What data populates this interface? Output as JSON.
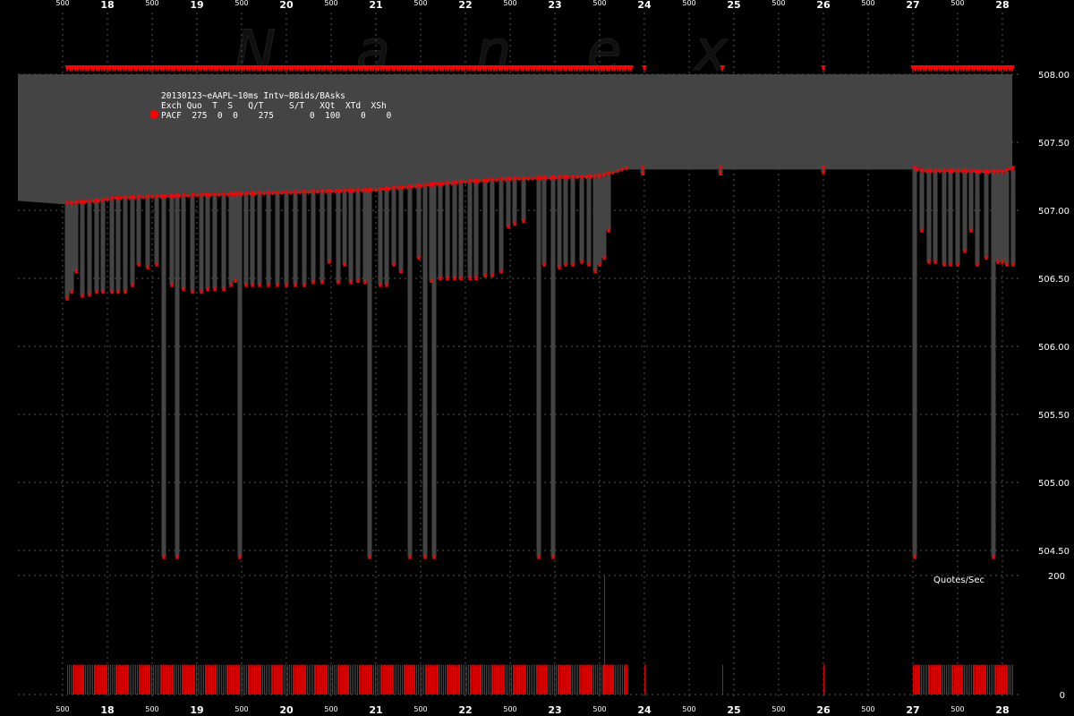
{
  "watermark": [
    "N",
    "a",
    "n",
    "e",
    "x"
  ],
  "info_panel": {
    "title": "20130123~eAAPL~10ms Intv~BBids/BAsks",
    "header": "Exch Quo  T  S   Q/T     S/T   XQt  XTd  XSh",
    "row": "PACF  275  0  0    275       0  100    0    0",
    "marker_color": "#ff0000"
  },
  "colors": {
    "background": "#000000",
    "spread_fill": "#444444",
    "marker": "#ff0000",
    "grid": "#555555",
    "text": "#ffffff",
    "quote_bar": "#dd0000"
  },
  "chart_data": {
    "type": "area",
    "title": "20130123~eAAPL~10ms Intv~BBids/BAsks",
    "x_major_ticks": [
      "18",
      "19",
      "20",
      "21",
      "22",
      "23",
      "24",
      "25",
      "26",
      "27",
      "28"
    ],
    "x_minor_tick_label": "500",
    "xlim": [
      17.45,
      28.12
    ],
    "price_panel": {
      "ylim": [
        504.3,
        508.3
      ],
      "y_ticks": [
        "504.50",
        "505.00",
        "505.50",
        "506.00",
        "506.50",
        "507.00",
        "507.50",
        "508.00"
      ],
      "best_ask_level": 508.0,
      "series": [
        {
          "name": "BBids",
          "points": [
            [
              17.0,
              507.07
            ],
            [
              17.6,
              507.04
            ],
            [
              17.7,
              507.05
            ],
            [
              17.9,
              507.06
            ],
            [
              18.1,
              507.08
            ],
            [
              18.5,
              507.09
            ],
            [
              19.0,
              507.1
            ],
            [
              19.5,
              507.11
            ],
            [
              20.0,
              507.12
            ],
            [
              20.5,
              507.13
            ],
            [
              21.0,
              507.14
            ],
            [
              21.5,
              507.17
            ],
            [
              22.0,
              507.2
            ],
            [
              22.5,
              507.22
            ],
            [
              23.0,
              507.23
            ],
            [
              23.5,
              507.24
            ],
            [
              23.8,
              507.3
            ],
            [
              24.0,
              507.3
            ],
            [
              27.0,
              507.3
            ],
            [
              27.1,
              507.28
            ],
            [
              27.5,
              507.28
            ],
            [
              28.0,
              507.27
            ],
            [
              28.12,
              507.3
            ]
          ],
          "drops": [
            [
              17.55,
              506.35
            ],
            [
              17.6,
              506.4
            ],
            [
              17.65,
              506.55
            ],
            [
              17.72,
              506.37
            ],
            [
              17.8,
              506.38
            ],
            [
              17.88,
              506.4
            ],
            [
              17.95,
              506.4
            ],
            [
              18.05,
              506.4
            ],
            [
              18.12,
              506.4
            ],
            [
              18.2,
              506.4
            ],
            [
              18.28,
              506.45
            ],
            [
              18.35,
              506.6
            ],
            [
              18.45,
              506.58
            ],
            [
              18.55,
              506.6
            ],
            [
              18.63,
              504.45
            ],
            [
              18.72,
              506.45
            ],
            [
              18.78,
              504.45
            ],
            [
              18.85,
              506.42
            ],
            [
              18.95,
              506.4
            ],
            [
              19.05,
              506.4
            ],
            [
              19.12,
              506.42
            ],
            [
              19.2,
              506.42
            ],
            [
              19.3,
              506.42
            ],
            [
              19.38,
              506.45
            ],
            [
              19.43,
              506.48
            ],
            [
              19.48,
              504.45
            ],
            [
              19.55,
              506.45
            ],
            [
              19.62,
              506.45
            ],
            [
              19.7,
              506.45
            ],
            [
              19.8,
              506.45
            ],
            [
              19.9,
              506.45
            ],
            [
              20.0,
              506.45
            ],
            [
              20.1,
              506.45
            ],
            [
              20.2,
              506.45
            ],
            [
              20.3,
              506.47
            ],
            [
              20.4,
              506.47
            ],
            [
              20.48,
              506.62
            ],
            [
              20.58,
              506.47
            ],
            [
              20.65,
              506.6
            ],
            [
              20.72,
              506.47
            ],
            [
              20.8,
              506.48
            ],
            [
              20.88,
              506.47
            ],
            [
              20.93,
              504.45
            ],
            [
              21.05,
              506.45
            ],
            [
              21.12,
              506.45
            ],
            [
              21.2,
              506.6
            ],
            [
              21.28,
              506.55
            ],
            [
              21.38,
              504.45
            ],
            [
              21.48,
              506.65
            ],
            [
              21.55,
              504.45
            ],
            [
              21.62,
              506.48
            ],
            [
              21.65,
              504.45
            ],
            [
              21.72,
              506.5
            ],
            [
              21.8,
              506.5
            ],
            [
              21.88,
              506.5
            ],
            [
              21.95,
              506.5
            ],
            [
              22.05,
              506.5
            ],
            [
              22.12,
              506.5
            ],
            [
              22.22,
              506.52
            ],
            [
              22.3,
              506.52
            ],
            [
              22.4,
              506.55
            ],
            [
              22.48,
              506.88
            ],
            [
              22.55,
              506.9
            ],
            [
              22.65,
              506.92
            ],
            [
              22.82,
              504.45
            ],
            [
              22.88,
              506.6
            ],
            [
              22.98,
              504.45
            ],
            [
              23.05,
              506.58
            ],
            [
              23.12,
              506.6
            ],
            [
              23.2,
              506.6
            ],
            [
              23.3,
              506.62
            ],
            [
              23.38,
              506.6
            ],
            [
              23.45,
              506.55
            ],
            [
              23.5,
              506.6
            ],
            [
              23.55,
              506.65
            ],
            [
              23.6,
              506.85
            ],
            [
              23.98,
              507.27
            ],
            [
              24.85,
              507.27
            ],
            [
              26.0,
              507.28
            ],
            [
              27.02,
              504.45
            ],
            [
              27.1,
              506.85
            ],
            [
              27.18,
              506.62
            ],
            [
              27.25,
              506.62
            ],
            [
              27.35,
              506.6
            ],
            [
              27.42,
              506.6
            ],
            [
              27.5,
              506.6
            ],
            [
              27.58,
              506.7
            ],
            [
              27.65,
              506.85
            ],
            [
              27.72,
              506.6
            ],
            [
              27.82,
              506.65
            ],
            [
              27.9,
              504.45
            ],
            [
              27.95,
              506.62
            ],
            [
              28.0,
              506.62
            ],
            [
              28.05,
              506.6
            ],
            [
              28.12,
              506.6
            ]
          ]
        },
        {
          "name": "BAsks",
          "points": [
            [
              17.0,
              508.0
            ],
            [
              28.12,
              508.0
            ]
          ],
          "markers_x_ranges": [
            [
              17.55,
              23.85
            ],
            [
              24.0,
              24.0
            ],
            [
              24.87,
              24.87
            ],
            [
              26.0,
              26.0
            ],
            [
              27.0,
              28.12
            ]
          ]
        }
      ]
    },
    "volume_panel": {
      "label": "Quotes/Sec",
      "ylim": [
        0,
        200
      ],
      "y_ticks": [
        "200",
        "0"
      ],
      "active_ranges": [
        [
          17.55,
          23.82
        ],
        [
          27.0,
          28.12
        ]
      ],
      "typical_value": 50,
      "spikes": [
        [
          23.55,
          200
        ],
        [
          24.0,
          50
        ],
        [
          24.87,
          50
        ],
        [
          26.0,
          50
        ]
      ]
    }
  }
}
